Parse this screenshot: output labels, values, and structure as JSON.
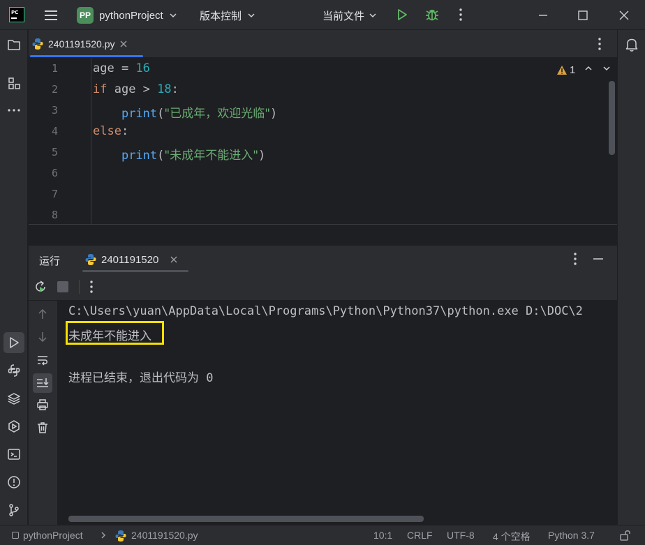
{
  "title_bar": {
    "project_badge": "PP",
    "project_name": "pythonProject",
    "vcs_menu": "版本控制",
    "run_config": "当前文件"
  },
  "editor_tab": {
    "filename": "2401191520.py"
  },
  "editor": {
    "line_numbers": [
      "1",
      "2",
      "3",
      "4",
      "5",
      "6",
      "7",
      "8"
    ],
    "lines": [
      {
        "t1": "age",
        "t2": " = ",
        "t3": "16"
      },
      {
        "t1": "if",
        "t2": " age > ",
        "t3": "18",
        "t4": ":"
      },
      {
        "t1": "    ",
        "t2": "print",
        "t3": "(",
        "t4": "\"已成年，欢迎光临\"",
        "t5": ")"
      },
      {
        "t1": "else",
        "t2": ":"
      },
      {
        "t1": "    ",
        "t2": "print",
        "t3": "(",
        "t4": "\"未成年不能进入\"",
        "t5": ")"
      }
    ],
    "warning_count": "1"
  },
  "run_panel": {
    "title": "运行",
    "tab_label": "2401191520"
  },
  "console": {
    "command": "C:\\Users\\yuan\\AppData\\Local\\Programs\\Python\\Python37\\python.exe D:\\DOC\\2",
    "output": "未成年不能进入",
    "exit_message": "进程已结束，退出代码为 0"
  },
  "status_bar": {
    "project": "pythonProject",
    "file": "2401191520.py",
    "position": "10:1",
    "line_sep": "CRLF",
    "encoding": "UTF-8",
    "indent": "4 个空格",
    "interpreter": "Python 3.7"
  },
  "colors": {
    "accent": "#3574f0",
    "highlight_box": "#f5e000",
    "run_green": "#5fb865"
  }
}
